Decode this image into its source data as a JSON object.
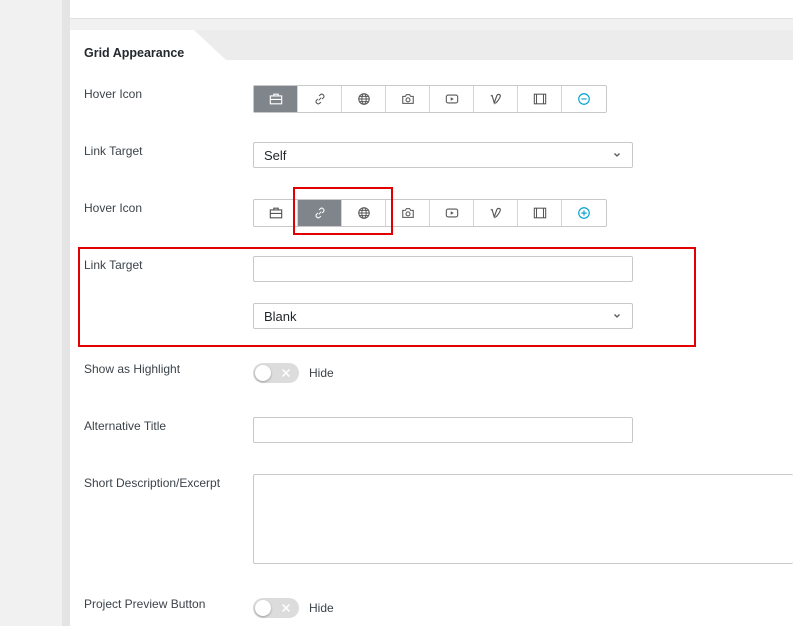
{
  "section": {
    "title": "Grid Appearance"
  },
  "rows": {
    "hover_icon_1": {
      "label": "Hover Icon"
    },
    "link_target_1": {
      "label": "Link Target",
      "value": "Self"
    },
    "hover_icon_2": {
      "label": "Hover Icon"
    },
    "link_target_2": {
      "label": "Link Target",
      "input_value": "",
      "value": "Blank"
    },
    "show_highlight": {
      "label": "Show as Highlight",
      "state": "Hide"
    },
    "alt_title": {
      "label": "Alternative Title",
      "value": ""
    },
    "short_desc": {
      "label": "Short Description/Excerpt",
      "value": ""
    },
    "preview_button": {
      "label": "Project Preview Button",
      "state": "Hide"
    }
  },
  "icon_set_1": {
    "icons": [
      "briefcase-icon",
      "link-icon",
      "globe-icon",
      "camera-icon",
      "youtube-icon",
      "vimeo-icon",
      "film-icon",
      "minus-circle-icon"
    ],
    "active_index": 0
  },
  "icon_set_2": {
    "icons": [
      "briefcase-icon",
      "link-icon",
      "globe-icon",
      "camera-icon",
      "youtube-icon",
      "vimeo-icon",
      "film-icon",
      "plus-circle-icon"
    ],
    "active_index": 1
  },
  "colors": {
    "active_icon_bg": "#80858c",
    "accent": "#00a0d2",
    "highlight_box": "#e00000"
  }
}
